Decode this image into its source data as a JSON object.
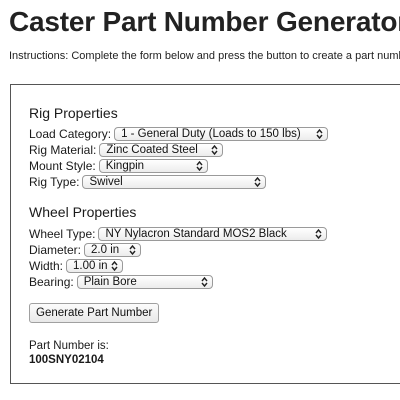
{
  "title": "Caster Part Number Generator",
  "instructions": "Instructions: Complete the form below and press the button to create a part number.",
  "rig": {
    "heading": "Rig Properties",
    "load_category": {
      "label": "Load Category:",
      "value": "1 - General Duty (Loads to 150 lbs)"
    },
    "rig_material": {
      "label": "Rig Material:",
      "value": "Zinc Coated Steel"
    },
    "mount_style": {
      "label": "Mount Style:",
      "value": "Kingpin"
    },
    "rig_type": {
      "label": "Rig Type:",
      "value": "Swivel"
    }
  },
  "wheel": {
    "heading": "Wheel Properties",
    "wheel_type": {
      "label": "Wheel Type:",
      "value": "NY Nylacron Standard MOS2 Black"
    },
    "diameter": {
      "label": "Diameter:",
      "value": "2.0 in"
    },
    "width": {
      "label": "Width:",
      "value": "1.00 in"
    },
    "bearing": {
      "label": "Bearing:",
      "value": "Plain Bore"
    }
  },
  "generate_button": "Generate Part Number",
  "result": {
    "label": "Part Number is:",
    "value": "100SNY02104"
  },
  "icons": {
    "select_chevron": "chevron-up-down-icon"
  },
  "colors": {
    "text": "#1a1a1a",
    "border": "#555555"
  }
}
